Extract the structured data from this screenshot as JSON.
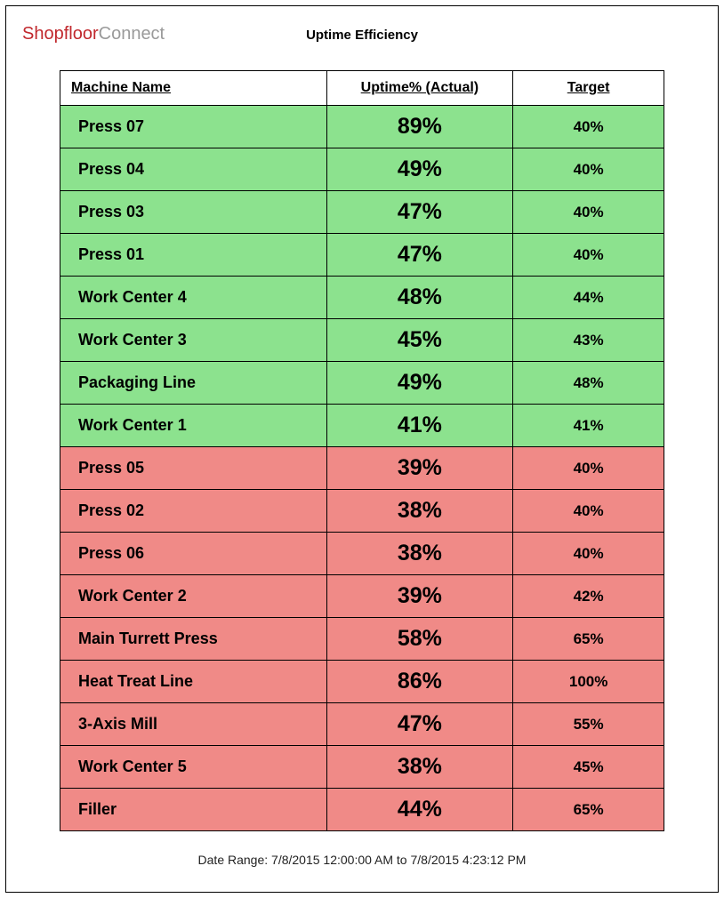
{
  "logo": {
    "part1": "Shopfloor",
    "part2": "Connect"
  },
  "title": "Uptime Efficiency",
  "columns": {
    "machine": "Machine Name",
    "actual": "Uptime% (Actual)",
    "target": "Target"
  },
  "rows": [
    {
      "machine": "Press 07",
      "actual": "89%",
      "target": "40%",
      "status": "ok"
    },
    {
      "machine": "Press 04",
      "actual": "49%",
      "target": "40%",
      "status": "ok"
    },
    {
      "machine": "Press 03",
      "actual": "47%",
      "target": "40%",
      "status": "ok"
    },
    {
      "machine": "Press 01",
      "actual": "47%",
      "target": "40%",
      "status": "ok"
    },
    {
      "machine": "Work Center 4",
      "actual": "48%",
      "target": "44%",
      "status": "ok"
    },
    {
      "machine": "Work Center 3",
      "actual": "45%",
      "target": "43%",
      "status": "ok"
    },
    {
      "machine": "Packaging Line",
      "actual": "49%",
      "target": "48%",
      "status": "ok"
    },
    {
      "machine": "Work Center 1",
      "actual": "41%",
      "target": "41%",
      "status": "ok"
    },
    {
      "machine": "Press 05",
      "actual": "39%",
      "target": "40%",
      "status": "bad"
    },
    {
      "machine": "Press 02",
      "actual": "38%",
      "target": "40%",
      "status": "bad"
    },
    {
      "machine": "Press 06",
      "actual": "38%",
      "target": "40%",
      "status": "bad"
    },
    {
      "machine": "Work Center 2",
      "actual": "39%",
      "target": "42%",
      "status": "bad"
    },
    {
      "machine": "Main Turrett Press",
      "actual": "58%",
      "target": "65%",
      "status": "bad"
    },
    {
      "machine": "Heat Treat Line",
      "actual": "86%",
      "target": "100%",
      "status": "bad"
    },
    {
      "machine": "3-Axis Mill",
      "actual": "47%",
      "target": "55%",
      "status": "bad"
    },
    {
      "machine": "Work Center 5",
      "actual": "38%",
      "target": "45%",
      "status": "bad"
    },
    {
      "machine": "Filler",
      "actual": "44%",
      "target": "65%",
      "status": "bad"
    }
  ],
  "footer": "Date Range: 7/8/2015 12:00:00 AM to 7/8/2015 4:23:12 PM",
  "chart_data": {
    "type": "table",
    "title": "Uptime Efficiency",
    "columns": [
      "Machine Name",
      "Uptime% (Actual)",
      "Target"
    ],
    "data": [
      [
        "Press 07",
        89,
        40
      ],
      [
        "Press 04",
        49,
        40
      ],
      [
        "Press 03",
        47,
        40
      ],
      [
        "Press 01",
        47,
        40
      ],
      [
        "Work Center 4",
        48,
        44
      ],
      [
        "Work Center 3",
        45,
        43
      ],
      [
        "Packaging Line",
        49,
        48
      ],
      [
        "Work Center 1",
        41,
        41
      ],
      [
        "Press 05",
        39,
        40
      ],
      [
        "Press 02",
        38,
        40
      ],
      [
        "Press 06",
        38,
        40
      ],
      [
        "Work Center 2",
        39,
        42
      ],
      [
        "Main Turrett Press",
        58,
        65
      ],
      [
        "Heat Treat Line",
        86,
        100
      ],
      [
        "3-Axis Mill",
        47,
        55
      ],
      [
        "Work Center 5",
        38,
        45
      ],
      [
        "Filler",
        44,
        65
      ]
    ]
  }
}
